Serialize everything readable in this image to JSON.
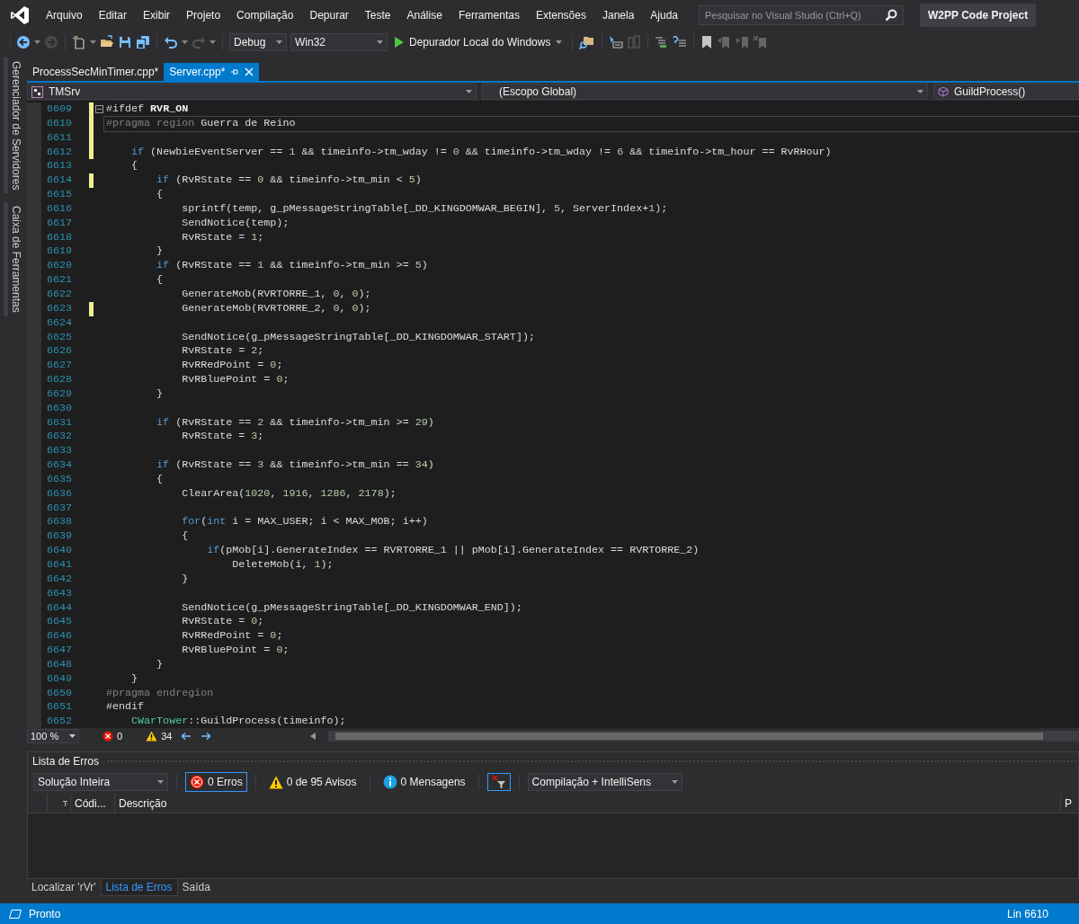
{
  "menu": [
    "Arquivo",
    "Editar",
    "Exibir",
    "Projeto",
    "Compilação",
    "Depurar",
    "Teste",
    "Análise",
    "Ferramentas",
    "Extensões",
    "Janela",
    "Ajuda"
  ],
  "search": {
    "placeholder": "Pesquisar no Visual Studio (Ctrl+Q)"
  },
  "project_title": "W2PP Code Project",
  "toolbar": {
    "buttons": [
      {
        "kind": "back",
        "disabled": false
      },
      {
        "kind": "forward",
        "disabled": true
      },
      {
        "kind": "new",
        "disabled": false
      },
      {
        "kind": "open",
        "disabled": false
      },
      {
        "kind": "save",
        "disabled": false
      },
      {
        "kind": "save_all",
        "disabled": false
      },
      {
        "kind": "undo",
        "disabled": false
      },
      {
        "kind": "redo",
        "disabled": true
      }
    ],
    "configuration": "Debug",
    "platform": "Win32",
    "start": "Depurador Local do Windows",
    "tools": [
      {
        "kind": "find",
        "disabled": false
      },
      {
        "kind": "select",
        "disabled": false
      },
      {
        "kind": "columns",
        "disabled": true
      },
      {
        "kind": "comment",
        "disabled": false
      },
      {
        "kind": "uncomment",
        "disabled": false
      },
      {
        "kind": "bookmark",
        "disabled": false
      },
      {
        "kind": "bookmark_prev",
        "disabled": true
      },
      {
        "kind": "bookmark_next",
        "disabled": true
      },
      {
        "kind": "bookmark_clear",
        "disabled": true
      }
    ]
  },
  "side_tabs": [
    "Gerenciador de Servidores",
    "Caixa de Ferramentas"
  ],
  "document_tabs": [
    {
      "label": "ProcessSecMinTimer.cpp*",
      "selected": false
    },
    {
      "label": "Server.cpp*",
      "selected": true
    }
  ],
  "navigation": {
    "project": "TMSrv",
    "scope": "(Escopo Global)",
    "member": "GuildProcess()"
  },
  "code_lines": [
    {
      "number": "6609",
      "modified": true,
      "current": false,
      "expanded": true,
      "code": [
        {
          "kind": "plain",
          "text": "#ifdef "
        },
        {
          "kind": "macro",
          "text": "RVR_ON"
        }
      ]
    },
    {
      "number": "6610",
      "modified": true,
      "current": true,
      "code": [
        {
          "kind": "dim",
          "text": "#pragma region "
        },
        {
          "kind": "plain",
          "text": "Guerra de Reino"
        }
      ]
    },
    {
      "number": "6611",
      "modified": true,
      "current": false
    },
    {
      "number": "6612",
      "modified": true,
      "current": false,
      "code": [
        {
          "kind": "kw",
          "text": "    if"
        },
        {
          "kind": "plain",
          "text": " (NewbieEventServer == "
        },
        {
          "kind": "num",
          "text": "1"
        },
        {
          "kind": "plain",
          "text": " && timeinfo->tm_wday != "
        },
        {
          "kind": "num",
          "text": "0"
        },
        {
          "kind": "plain",
          "text": " && timeinfo->tm_wday != "
        },
        {
          "kind": "num",
          "text": "6"
        },
        {
          "kind": "plain",
          "text": " && timeinfo->tm_hour == RvRHour)"
        }
      ]
    },
    {
      "number": "6613",
      "modified": false,
      "current": false,
      "code": [
        {
          "kind": "plain",
          "text": "    {"
        }
      ]
    },
    {
      "number": "6614",
      "modified": true,
      "current": false,
      "code": [
        {
          "kind": "kw",
          "text": "        if"
        },
        {
          "kind": "plain",
          "text": " (RvRState == "
        },
        {
          "kind": "num",
          "text": "0"
        },
        {
          "kind": "plain",
          "text": " && timeinfo->tm_min < "
        },
        {
          "kind": "num",
          "text": "5"
        },
        {
          "kind": "plain",
          "text": ")"
        }
      ]
    },
    {
      "number": "6615",
      "modified": false,
      "current": false,
      "code": [
        {
          "kind": "plain",
          "text": "        {"
        }
      ]
    },
    {
      "number": "6616",
      "modified": false,
      "current": false,
      "code": [
        {
          "kind": "plain",
          "text": "            sprintf(temp, g_pMessageStringTable[_DD_KINGDOMWAR_BEGIN], "
        },
        {
          "kind": "num",
          "text": "5"
        },
        {
          "kind": "plain",
          "text": ", ServerIndex+"
        },
        {
          "kind": "num",
          "text": "1"
        },
        {
          "kind": "plain",
          "text": ");"
        }
      ]
    },
    {
      "number": "6617",
      "modified": false,
      "current": false,
      "code": [
        {
          "kind": "plain",
          "text": "            SendNotice(temp);"
        }
      ]
    },
    {
      "number": "6618",
      "modified": false,
      "current": false,
      "code": [
        {
          "kind": "plain",
          "text": "            RvRState = "
        },
        {
          "kind": "num",
          "text": "1"
        },
        {
          "kind": "plain",
          "text": ";"
        }
      ]
    },
    {
      "number": "6619",
      "modified": false,
      "current": false,
      "code": [
        {
          "kind": "plain",
          "text": "        }"
        }
      ]
    },
    {
      "number": "6620",
      "modified": false,
      "current": false,
      "code": [
        {
          "kind": "kw",
          "text": "        if"
        },
        {
          "kind": "plain",
          "text": " (RvRState == "
        },
        {
          "kind": "num",
          "text": "1"
        },
        {
          "kind": "plain",
          "text": " && timeinfo->tm_min >= "
        },
        {
          "kind": "num",
          "text": "5"
        },
        {
          "kind": "plain",
          "text": ")"
        }
      ]
    },
    {
      "number": "6621",
      "modified": false,
      "current": false,
      "code": [
        {
          "kind": "plain",
          "text": "        {"
        }
      ]
    },
    {
      "number": "6622",
      "modified": false,
      "current": false,
      "code": [
        {
          "kind": "plain",
          "text": "            GenerateMob(RVRTORRE_1, "
        },
        {
          "kind": "num",
          "text": "0"
        },
        {
          "kind": "plain",
          "text": ", "
        },
        {
          "kind": "num",
          "text": "0"
        },
        {
          "kind": "plain",
          "text": ");"
        }
      ]
    },
    {
      "number": "6623",
      "modified": true,
      "current": false,
      "code": [
        {
          "kind": "plain",
          "text": "            GenerateMob(RVRTORRE_2, "
        },
        {
          "kind": "num",
          "text": "0"
        },
        {
          "kind": "plain",
          "text": ", "
        },
        {
          "kind": "num",
          "text": "0"
        },
        {
          "kind": "plain",
          "text": ");"
        }
      ]
    },
    {
      "number": "6624",
      "modified": false,
      "current": false
    },
    {
      "number": "6625",
      "modified": false,
      "current": false,
      "code": [
        {
          "kind": "plain",
          "text": "            SendNotice(g_pMessageStringTable[_DD_KINGDOMWAR_START]);"
        }
      ]
    },
    {
      "number": "6626",
      "modified": false,
      "current": false,
      "code": [
        {
          "kind": "plain",
          "text": "            RvRState = "
        },
        {
          "kind": "num",
          "text": "2"
        },
        {
          "kind": "plain",
          "text": ";"
        }
      ]
    },
    {
      "number": "6627",
      "modified": false,
      "current": false,
      "code": [
        {
          "kind": "plain",
          "text": "            RvRRedPoint = "
        },
        {
          "kind": "num",
          "text": "0"
        },
        {
          "kind": "plain",
          "text": ";"
        }
      ]
    },
    {
      "number": "6628",
      "modified": false,
      "current": false,
      "code": [
        {
          "kind": "plain",
          "text": "            RvRBluePoint = "
        },
        {
          "kind": "num",
          "text": "0"
        },
        {
          "kind": "plain",
          "text": ";"
        }
      ]
    },
    {
      "number": "6629",
      "modified": false,
      "current": false,
      "code": [
        {
          "kind": "plain",
          "text": "        }"
        }
      ]
    },
    {
      "number": "6630",
      "modified": false,
      "current": false
    },
    {
      "number": "6631",
      "modified": false,
      "current": false,
      "code": [
        {
          "kind": "kw",
          "text": "        if"
        },
        {
          "kind": "plain",
          "text": " (RvRState == "
        },
        {
          "kind": "num",
          "text": "2"
        },
        {
          "kind": "plain",
          "text": " && timeinfo->tm_min >= "
        },
        {
          "kind": "num",
          "text": "29"
        },
        {
          "kind": "plain",
          "text": ")"
        }
      ]
    },
    {
      "number": "6632",
      "modified": false,
      "current": false,
      "code": [
        {
          "kind": "plain",
          "text": "            RvRState = "
        },
        {
          "kind": "num",
          "text": "3"
        },
        {
          "kind": "plain",
          "text": ";"
        }
      ]
    },
    {
      "number": "6633",
      "modified": false,
      "current": false
    },
    {
      "number": "6634",
      "modified": false,
      "current": false,
      "code": [
        {
          "kind": "kw",
          "text": "        if"
        },
        {
          "kind": "plain",
          "text": " (RvRState == "
        },
        {
          "kind": "num",
          "text": "3"
        },
        {
          "kind": "plain",
          "text": " && timeinfo->tm_min == "
        },
        {
          "kind": "num",
          "text": "34"
        },
        {
          "kind": "plain",
          "text": ")"
        }
      ]
    },
    {
      "number": "6635",
      "modified": false,
      "current": false,
      "code": [
        {
          "kind": "plain",
          "text": "        {"
        }
      ]
    },
    {
      "number": "6636",
      "modified": false,
      "current": false,
      "code": [
        {
          "kind": "plain",
          "text": "            ClearArea("
        },
        {
          "kind": "num",
          "text": "1020"
        },
        {
          "kind": "plain",
          "text": ", "
        },
        {
          "kind": "num",
          "text": "1916"
        },
        {
          "kind": "plain",
          "text": ", "
        },
        {
          "kind": "num",
          "text": "1286"
        },
        {
          "kind": "plain",
          "text": ", "
        },
        {
          "kind": "num",
          "text": "2178"
        },
        {
          "kind": "plain",
          "text": ");"
        }
      ]
    },
    {
      "number": "6637",
      "modified": false,
      "current": false
    },
    {
      "number": "6638",
      "modified": false,
      "current": false,
      "code": [
        {
          "kind": "kw",
          "text": "            for"
        },
        {
          "kind": "plain",
          "text": "("
        },
        {
          "kind": "kw",
          "text": "int"
        },
        {
          "kind": "plain",
          "text": " i = MAX_USER; i < MAX_MOB; i++)"
        }
      ]
    },
    {
      "number": "6639",
      "modified": false,
      "current": false,
      "code": [
        {
          "kind": "plain",
          "text": "            {"
        }
      ]
    },
    {
      "number": "6640",
      "modified": false,
      "current": false,
      "code": [
        {
          "kind": "kw",
          "text": "                if"
        },
        {
          "kind": "plain",
          "text": "(pMob[i].GenerateIndex == RVRTORRE_1 || pMob[i].GenerateIndex == RVRTORRE_2)"
        }
      ]
    },
    {
      "number": "6641",
      "modified": false,
      "current": false,
      "code": [
        {
          "kind": "plain",
          "text": "                    DeleteMob(i, "
        },
        {
          "kind": "num",
          "text": "1"
        },
        {
          "kind": "plain",
          "text": ");"
        }
      ]
    },
    {
      "number": "6642",
      "modified": false,
      "current": false,
      "code": [
        {
          "kind": "plain",
          "text": "            }"
        }
      ]
    },
    {
      "number": "6643",
      "modified": false,
      "current": false
    },
    {
      "number": "6644",
      "modified": false,
      "current": false,
      "code": [
        {
          "kind": "plain",
          "text": "            SendNotice(g_pMessageStringTable[_DD_KINGDOMWAR_END]);"
        }
      ]
    },
    {
      "number": "6645",
      "modified": false,
      "current": false,
      "code": [
        {
          "kind": "plain",
          "text": "            RvRState = "
        },
        {
          "kind": "num",
          "text": "0"
        },
        {
          "kind": "plain",
          "text": ";"
        }
      ]
    },
    {
      "number": "6646",
      "modified": false,
      "current": false,
      "code": [
        {
          "kind": "plain",
          "text": "            RvRRedPoint = "
        },
        {
          "kind": "num",
          "text": "0"
        },
        {
          "kind": "plain",
          "text": ";"
        }
      ]
    },
    {
      "number": "6647",
      "modified": false,
      "current": false,
      "code": [
        {
          "kind": "plain",
          "text": "            RvRBluePoint = "
        },
        {
          "kind": "num",
          "text": "0"
        },
        {
          "kind": "plain",
          "text": ";"
        }
      ]
    },
    {
      "number": "6648",
      "modified": false,
      "current": false,
      "code": [
        {
          "kind": "plain",
          "text": "        }"
        }
      ]
    },
    {
      "number": "6649",
      "modified": false,
      "current": false,
      "code": [
        {
          "kind": "plain",
          "text": "    }"
        }
      ]
    },
    {
      "number": "6650",
      "modified": false,
      "current": false,
      "code": [
        {
          "kind": "dim",
          "text": "#pragma endregion"
        }
      ]
    },
    {
      "number": "6651",
      "modified": false,
      "current": false,
      "code": [
        {
          "kind": "plain",
          "text": "#endif"
        }
      ]
    },
    {
      "number": "6652",
      "modified": false,
      "current": false,
      "code": [
        {
          "kind": "type",
          "text": "    CWarTower"
        },
        {
          "kind": "plain",
          "text": "::GuildProcess(timeinfo);"
        }
      ]
    }
  ],
  "editor_footer": {
    "zoom": "100 %",
    "errors": "0",
    "warnings": "34"
  },
  "error_list": {
    "title": "Lista de Erros",
    "scope": "Solução Inteira",
    "filters": [
      {
        "kind": "error",
        "label": "0 Erros",
        "selected": true
      },
      {
        "kind": "warning",
        "label": "0 de 95 Avisos",
        "selected": false
      },
      {
        "kind": "info",
        "label": "0 Mensagens",
        "selected": false
      }
    ],
    "source": "Compilação + IntelliSens",
    "columns": [
      "Códi...",
      "Descrição",
      "P"
    ]
  },
  "bottom_tabs": [
    {
      "label": "Localizar 'rVr'",
      "selected": false
    },
    {
      "label": "Lista de Erros",
      "selected": true
    },
    {
      "label": "Saída",
      "selected": false
    }
  ],
  "status_bar": {
    "text": "Pronto",
    "line": "Lin 6610"
  }
}
